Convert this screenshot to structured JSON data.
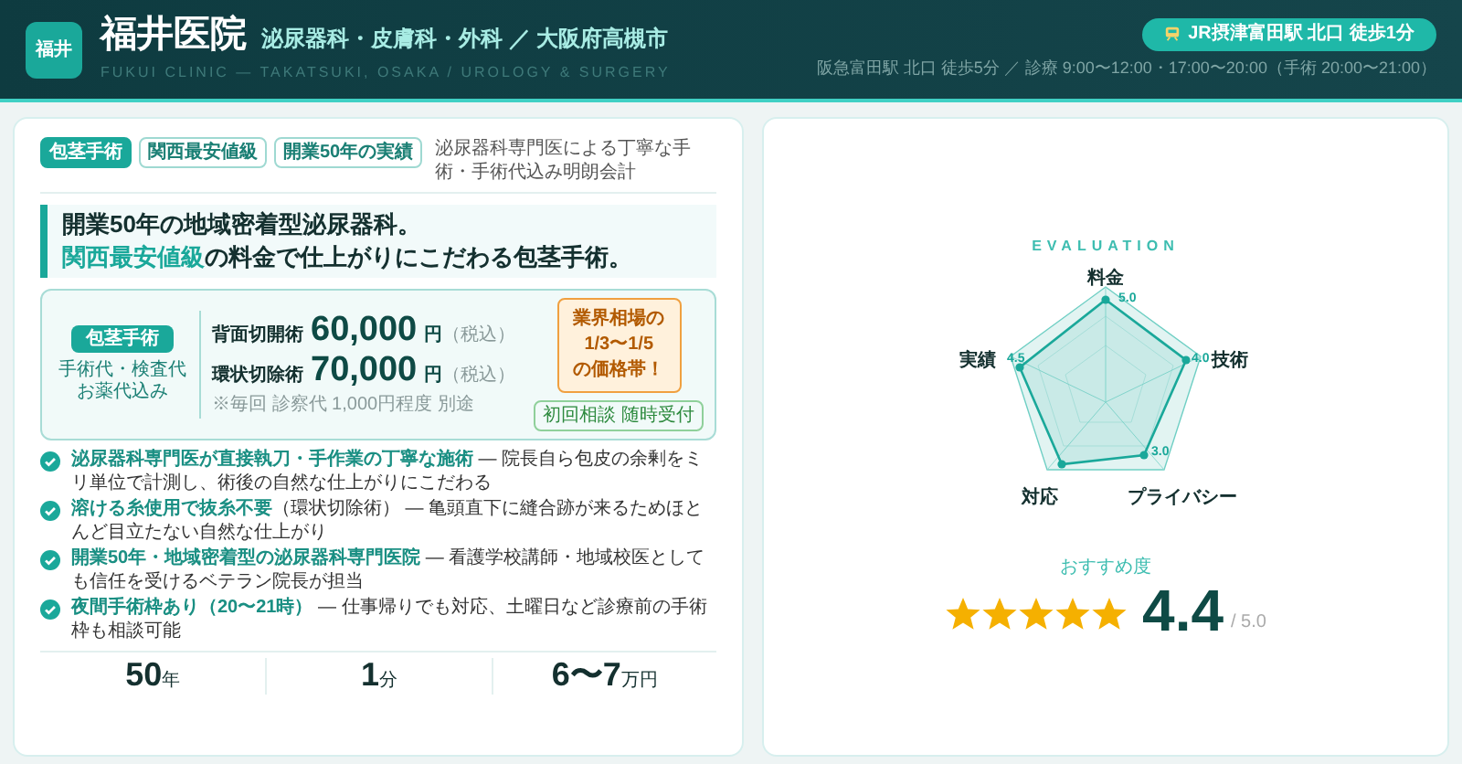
{
  "header": {
    "logo": "福井",
    "title": "福井医院",
    "subtitle": "泌尿器科・皮膚科・外科 ／ 大阪府高槻市",
    "tagline": "FUKUI CLINIC — TAKATSUKI, OSAKA / UROLOGY & SURGERY",
    "access_badge": "JR摂津富田駅 北口 徒歩1分",
    "access_note": "阪急富田駅 北口 徒歩5分 ／ 診療 9:00〜12:00・17:00〜20:00（手術 20:00〜21:00）"
  },
  "tags": [
    {
      "label": "包茎手術",
      "kind": "filled"
    },
    {
      "label": "関西最安値級",
      "kind": "outline"
    },
    {
      "label": "開業50年の実績",
      "kind": "outline"
    }
  ],
  "intro": "泌尿器科専門医による丁寧な手術・手術代込み明朗会計",
  "headline": {
    "line1": "開業50年の地域密着型泌尿器科。",
    "highlight": "関西最安値級",
    "line2_rest": "の料金で仕上がりにこだわる包茎手術。"
  },
  "price_box": {
    "badge": "包茎手術",
    "note_lines": [
      "手術代・検査代",
      "お薬代込み"
    ],
    "prices": [
      {
        "name": "背面切開術",
        "amount": "60,000",
        "unit": "円",
        "tax": "（税込）"
      },
      {
        "name": "環状切除術",
        "amount": "70,000",
        "unit": "円",
        "tax": "（税込）"
      }
    ],
    "footnote": "※毎回 診察代 1,000円程度 別途",
    "callout": "業界相場の\n1/3〜1/5\nの価格帯！",
    "consult": "初回相談 随時受付"
  },
  "features": [
    {
      "lead": "泌尿器科専門医が直接執刀・手作業の丁寧な施術",
      "body": " — 院長自ら包皮の余剰をミリ単位で計測し、術後の自然な仕上がりにこだわる"
    },
    {
      "lead": "溶ける糸使用で抜糸不要",
      "body": "（環状切除術） — 亀頭直下に縫合跡が来るためほとんど目立たない自然な仕上がり"
    },
    {
      "lead": "開業50年・地域密着型の泌尿器科専門医院",
      "body": " — 看護学校講師・地域校医としても信任を受けるベテラン院長が担当"
    },
    {
      "lead": "夜間手術枠あり（20〜21時）",
      "body": " — 仕事帰りでも対応、土曜日など診療前の手術枠も相談可能"
    }
  ],
  "stats": [
    {
      "value": "50",
      "unit": "年"
    },
    {
      "value": "1",
      "unit": "分"
    },
    {
      "value": "6〜7",
      "unit": "万円"
    }
  ],
  "evaluation": {
    "title": "EVALUATION",
    "axes": [
      {
        "label": "料金",
        "value": "5.0"
      },
      {
        "label": "実績",
        "value": "4.5"
      },
      {
        "label": "技術",
        "value": "4.0"
      },
      {
        "label": "対応"
      },
      {
        "label": "プライバシー",
        "value": "3.0"
      }
    ],
    "rating_label": "おすすめ度",
    "stars": 5,
    "score": "4.4",
    "out_of": "/ 5.0"
  }
}
